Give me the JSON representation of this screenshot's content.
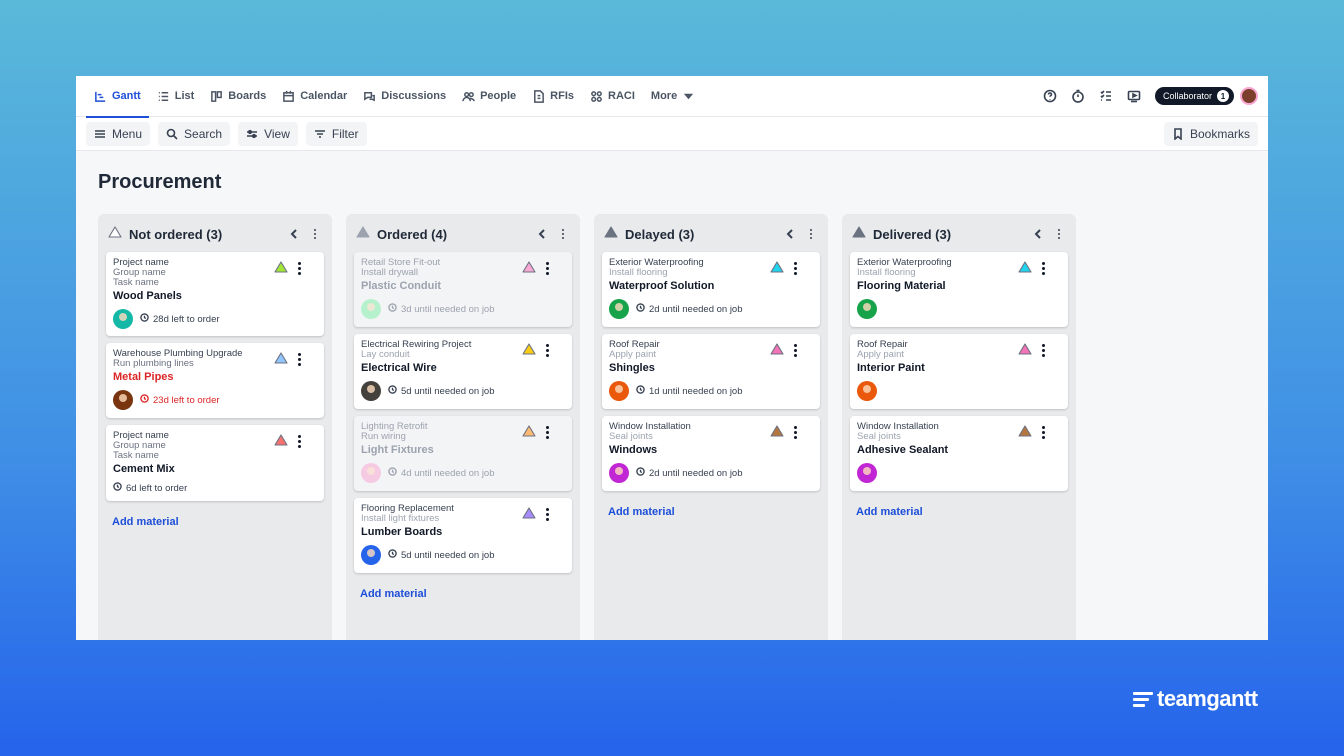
{
  "nav": {
    "tabs": [
      {
        "label": "Gantt",
        "icon": "gantt-icon"
      },
      {
        "label": "List",
        "icon": "list-icon"
      },
      {
        "label": "Boards",
        "icon": "boards-icon"
      },
      {
        "label": "Calendar",
        "icon": "calendar-icon"
      },
      {
        "label": "Discussions",
        "icon": "discussions-icon"
      },
      {
        "label": "People",
        "icon": "people-icon"
      },
      {
        "label": "RFIs",
        "icon": "rfi-icon"
      },
      {
        "label": "RACI",
        "icon": "raci-icon"
      },
      {
        "label": "More",
        "icon": "chevron-down-icon"
      }
    ],
    "active_tab": "Gantt",
    "collaborator_label": "Collaborator",
    "collaborator_count": "1"
  },
  "toolbar": {
    "menu": "Menu",
    "search": "Search",
    "view": "View",
    "filter": "Filter",
    "bookmarks": "Bookmarks"
  },
  "page": {
    "title": "Procurement"
  },
  "columns": [
    {
      "title": "Not ordered (3)",
      "status_color": "#ffffff",
      "add_label": "Add material",
      "cards": [
        {
          "project": "Project name",
          "group": "Group name",
          "task": "Task name",
          "material": "Wood Panels",
          "meta": "28d left to order",
          "tri_color": "#a3e635",
          "avatar_color": "#14b8a6"
        },
        {
          "project": "Warehouse Plumbing Upgrade",
          "group": "Run plumbing lines",
          "task": "",
          "material": "Metal Pipes",
          "meta": "23d left to order",
          "tri_color": "#93c5fd",
          "avatar_color": "#78350f",
          "overdue": true
        },
        {
          "project": "Project name",
          "group": "Group name",
          "task": "Task name",
          "material": "Cement Mix",
          "meta": "6d left to order",
          "tri_color": "#f87171",
          "avatar_color": ""
        }
      ]
    },
    {
      "title": "Ordered (4)",
      "status_color": "#9ca3af",
      "add_label": "Add material",
      "cards": [
        {
          "project": "Retail Store Fit-out",
          "group": "Install drywall",
          "material": "Plastic Conduit",
          "meta": "3d until needed on job",
          "tri_color": "#f9a8d4",
          "avatar_color": "#86efac",
          "dim": true
        },
        {
          "project": "Electrical Rewiring Project",
          "group": "Lay conduit",
          "material": "Electrical Wire",
          "meta": "5d until needed on job",
          "tri_color": "#facc15",
          "avatar_color": "#44403c"
        },
        {
          "project": "Lighting Retrofit",
          "group": "Run wiring",
          "material": "Light Fixtures",
          "meta": "4d until needed on job",
          "tri_color": "#fdba74",
          "avatar_color": "#f9a8d4",
          "dim": true
        },
        {
          "project": "Flooring Replacement",
          "group": "Install light fixtures",
          "material": "Lumber Boards",
          "meta": "5d until needed on job",
          "tri_color": "#a78bfa",
          "avatar_color": "#2563eb"
        }
      ]
    },
    {
      "title": "Delayed (3)",
      "status_color": "#6b7280",
      "add_label": "Add material",
      "cards": [
        {
          "project": "Exterior Waterproofing",
          "group": "Install flooring",
          "material": "Waterproof Solution",
          "meta": "2d until needed on job",
          "tri_color": "#22d3ee",
          "avatar_color": "#16a34a"
        },
        {
          "project": "Roof Repair",
          "group": "Apply paint",
          "material": "Shingles",
          "meta": "1d until needed on job",
          "tri_color": "#f472b6",
          "avatar_color": "#ea580c"
        },
        {
          "project": "Window Installation",
          "group": "Seal joints",
          "material": "Windows",
          "meta": "2d until needed on job",
          "tri_color": "#b4763f",
          "avatar_color": "#c026d3"
        }
      ]
    },
    {
      "title": "Delivered (3)",
      "status_color": "#6b7280",
      "add_label": "Add material",
      "cards": [
        {
          "project": "Exterior Waterproofing",
          "group": "Install flooring",
          "material": "Flooring Material",
          "meta": "",
          "tri_color": "#22d3ee",
          "avatar_color": "#16a34a"
        },
        {
          "project": "Roof Repair",
          "group": "Apply paint",
          "material": "Interior Paint",
          "meta": "",
          "tri_color": "#f472b6",
          "avatar_color": "#ea580c"
        },
        {
          "project": "Window Installation",
          "group": "Seal joints",
          "material": "Adhesive Sealant",
          "meta": "",
          "tri_color": "#b4763f",
          "avatar_color": "#c026d3"
        }
      ]
    }
  ],
  "brand": {
    "name": "teamgantt"
  }
}
